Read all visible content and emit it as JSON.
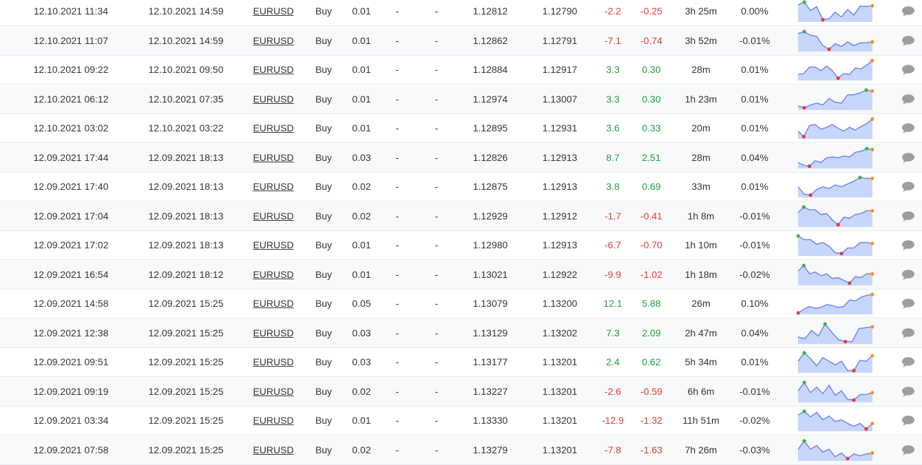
{
  "colors": {
    "positive": "#1ea03b",
    "negative": "#e53935",
    "sparkline_fill": "#c9d6fb",
    "sparkline_line": "#6f86f2",
    "marker_high": "#3cb043",
    "marker_low": "#e53935",
    "marker_last": "#ff8c1a",
    "comment_icon": "#9e9e9e"
  },
  "icons": {
    "sparkline": "sparkline-chart-icon",
    "comment": "comment-icon"
  },
  "trades": [
    {
      "open": "12.10.2021 11:34",
      "close": "12.10.2021 14:59",
      "symbol": "EURUSD",
      "action": "Buy",
      "lots": "0.01",
      "sl": "-",
      "tp": "-",
      "open_price": "1.12812",
      "close_price": "1.12790",
      "pips": "-2.2",
      "profit": "-0.25",
      "duration": "3h 25m",
      "gain": "0.00%",
      "positive": false,
      "spark": [
        0.85,
        1.0,
        0.55,
        0.75,
        0.05,
        0.1,
        0.45,
        0.2,
        0.6,
        0.3,
        0.78,
        0.76,
        0.8
      ],
      "hi": 1,
      "lo": 4
    },
    {
      "open": "12.10.2021 11:07",
      "close": "12.10.2021 14:59",
      "symbol": "EURUSD",
      "action": "Buy",
      "lots": "0.01",
      "sl": "-",
      "tp": "-",
      "open_price": "1.12862",
      "close_price": "1.12791",
      "pips": "-7.1",
      "profit": "-0.74",
      "duration": "3h 52m",
      "gain": "-0.01%",
      "positive": false,
      "spark": [
        0.9,
        1.0,
        0.8,
        0.75,
        0.25,
        0.05,
        0.35,
        0.2,
        0.45,
        0.25,
        0.4,
        0.4,
        0.45
      ],
      "hi": 1,
      "lo": 5
    },
    {
      "open": "12.10.2021 09:22",
      "close": "12.10.2021 09:50",
      "symbol": "EURUSD",
      "action": "Buy",
      "lots": "0.01",
      "sl": "-",
      "tp": "-",
      "open_price": "1.12884",
      "close_price": "1.12917",
      "pips": "3.3",
      "profit": "0.30",
      "duration": "28m",
      "gain": "0.01%",
      "positive": true,
      "spark": [
        0.25,
        0.3,
        0.65,
        0.65,
        0.45,
        0.7,
        0.45,
        0.05,
        0.3,
        0.25,
        0.6,
        0.55,
        0.75,
        1.0
      ],
      "hi": 13,
      "lo": 7
    },
    {
      "open": "12.10.2021 06:12",
      "close": "12.10.2021 07:35",
      "symbol": "EURUSD",
      "action": "Buy",
      "lots": "0.01",
      "sl": "-",
      "tp": "-",
      "open_price": "1.12974",
      "close_price": "1.13007",
      "pips": "3.3",
      "profit": "0.30",
      "duration": "1h 23m",
      "gain": "0.01%",
      "positive": true,
      "spark": [
        0.15,
        0.05,
        0.2,
        0.3,
        0.2,
        0.55,
        0.35,
        0.3,
        0.75,
        0.75,
        0.85,
        1.0,
        0.95
      ],
      "hi": 11,
      "lo": 1
    },
    {
      "open": "12.10.2021 03:02",
      "close": "12.10.2021 03:22",
      "symbol": "EURUSD",
      "action": "Buy",
      "lots": "0.01",
      "sl": "-",
      "tp": "-",
      "open_price": "1.12895",
      "close_price": "1.12931",
      "pips": "3.6",
      "profit": "0.33",
      "duration": "20m",
      "gain": "0.01%",
      "positive": true,
      "spark": [
        0.35,
        0.05,
        0.65,
        0.7,
        0.45,
        0.55,
        0.7,
        0.5,
        0.35,
        0.55,
        0.4,
        0.6,
        0.75,
        1.0
      ],
      "hi": 13,
      "lo": 1
    },
    {
      "open": "12.09.2021 17:44",
      "close": "12.09.2021 18:13",
      "symbol": "EURUSD",
      "action": "Buy",
      "lots": "0.03",
      "sl": "-",
      "tp": "-",
      "open_price": "1.12826",
      "close_price": "1.12913",
      "pips": "8.7",
      "profit": "2.51",
      "duration": "28m",
      "gain": "0.04%",
      "positive": true,
      "spark": [
        0.25,
        0.1,
        0.05,
        0.35,
        0.25,
        0.5,
        0.55,
        0.5,
        0.6,
        0.55,
        0.8,
        0.85,
        1.0,
        0.95
      ],
      "hi": 12,
      "lo": 2
    },
    {
      "open": "12.09.2021 17:40",
      "close": "12.09.2021 18:13",
      "symbol": "EURUSD",
      "action": "Buy",
      "lots": "0.02",
      "sl": "-",
      "tp": "-",
      "open_price": "1.12875",
      "close_price": "1.12913",
      "pips": "3.8",
      "profit": "0.69",
      "duration": "33m",
      "gain": "0.01%",
      "positive": true,
      "spark": [
        0.5,
        0.1,
        0.05,
        0.35,
        0.5,
        0.4,
        0.6,
        0.5,
        0.65,
        0.8,
        1.0,
        0.95,
        0.95
      ],
      "hi": 10,
      "lo": 2
    },
    {
      "open": "12.09.2021 17:04",
      "close": "12.09.2021 18:13",
      "symbol": "EURUSD",
      "action": "Buy",
      "lots": "0.02",
      "sl": "-",
      "tp": "-",
      "open_price": "1.12929",
      "close_price": "1.12912",
      "pips": "-1.7",
      "profit": "-0.41",
      "duration": "1h 8m",
      "gain": "-0.01%",
      "positive": false,
      "spark": [
        0.7,
        1.0,
        0.85,
        0.85,
        0.6,
        0.65,
        0.3,
        0.05,
        0.45,
        0.4,
        0.6,
        0.65,
        0.8,
        0.8
      ],
      "hi": 1,
      "lo": 7
    },
    {
      "open": "12.09.2021 17:02",
      "close": "12.09.2021 18:13",
      "symbol": "EURUSD",
      "action": "Buy",
      "lots": "0.01",
      "sl": "-",
      "tp": "-",
      "open_price": "1.12980",
      "close_price": "1.12913",
      "pips": "-6.7",
      "profit": "-0.70",
      "duration": "1h 10m",
      "gain": "-0.01%",
      "positive": false,
      "spark": [
        1.0,
        0.8,
        0.8,
        0.55,
        0.65,
        0.45,
        0.1,
        0.05,
        0.35,
        0.35,
        0.65,
        0.65,
        0.6
      ],
      "hi": 0,
      "lo": 7
    },
    {
      "open": "12.09.2021 16:54",
      "close": "12.09.2021 18:12",
      "symbol": "EURUSD",
      "action": "Buy",
      "lots": "0.01",
      "sl": "-",
      "tp": "-",
      "open_price": "1.13021",
      "close_price": "1.12922",
      "pips": "-9.9",
      "profit": "-1.02",
      "duration": "1h 18m",
      "gain": "-0.02%",
      "positive": false,
      "spark": [
        0.7,
        1.0,
        0.55,
        0.65,
        0.45,
        0.55,
        0.3,
        0.35,
        0.2,
        0.05,
        0.4,
        0.35,
        0.55,
        0.55
      ],
      "hi": 1,
      "lo": 9
    },
    {
      "open": "12.09.2021 14:58",
      "close": "12.09.2021 15:25",
      "symbol": "EURUSD",
      "action": "Buy",
      "lots": "0.05",
      "sl": "-",
      "tp": "-",
      "open_price": "1.13079",
      "close_price": "1.13200",
      "pips": "12.1",
      "profit": "5.88",
      "duration": "26m",
      "gain": "0.10%",
      "positive": true,
      "spark": [
        0.0,
        0.2,
        0.35,
        0.25,
        0.3,
        0.45,
        0.4,
        0.3,
        0.35,
        0.7,
        0.65,
        0.85,
        0.95,
        1.0
      ],
      "hi": 13,
      "lo": 0
    },
    {
      "open": "12.09.2021 12:38",
      "close": "12.09.2021 15:25",
      "symbol": "EURUSD",
      "action": "Buy",
      "lots": "0.03",
      "sl": "-",
      "tp": "-",
      "open_price": "1.13129",
      "close_price": "1.13202",
      "pips": "7.3",
      "profit": "2.09",
      "duration": "2h 47m",
      "gain": "0.04%",
      "positive": true,
      "spark": [
        0.3,
        0.2,
        0.65,
        0.35,
        1.0,
        0.55,
        0.15,
        0.05,
        0.05,
        0.75,
        0.8,
        0.85
      ],
      "hi": 4,
      "lo": 7
    },
    {
      "open": "12.09.2021 09:51",
      "close": "12.09.2021 15:25",
      "symbol": "EURUSD",
      "action": "Buy",
      "lots": "0.03",
      "sl": "-",
      "tp": "-",
      "open_price": "1.13177",
      "close_price": "1.13201",
      "pips": "2.4",
      "profit": "0.62",
      "duration": "5h 34m",
      "gain": "0.01%",
      "positive": true,
      "spark": [
        0.55,
        1.0,
        0.7,
        0.3,
        0.75,
        0.55,
        0.35,
        0.55,
        0.05,
        0.05,
        0.6,
        0.55,
        0.85
      ],
      "hi": 1,
      "lo": 9
    },
    {
      "open": "12.09.2021 09:19",
      "close": "12.09.2021 15:25",
      "symbol": "EURUSD",
      "action": "Buy",
      "lots": "0.02",
      "sl": "-",
      "tp": "-",
      "open_price": "1.13227",
      "close_price": "1.13201",
      "pips": "-2.6",
      "profit": "-0.59",
      "duration": "6h 6m",
      "gain": "-0.01%",
      "positive": false,
      "spark": [
        0.55,
        1.0,
        0.45,
        0.75,
        0.4,
        0.85,
        0.3,
        0.55,
        0.1,
        0.05,
        0.35,
        0.35,
        0.45
      ],
      "hi": 1,
      "lo": 9
    },
    {
      "open": "12.09.2021 03:34",
      "close": "12.09.2021 15:25",
      "symbol": "EURUSD",
      "action": "Buy",
      "lots": "0.01",
      "sl": "-",
      "tp": "-",
      "open_price": "1.13330",
      "close_price": "1.13201",
      "pips": "-12.9",
      "profit": "-1.32",
      "duration": "11h 51m",
      "gain": "-0.02%",
      "positive": false,
      "spark": [
        0.8,
        1.0,
        0.7,
        0.95,
        0.55,
        0.75,
        0.45,
        0.55,
        0.35,
        0.2,
        0.35,
        0.05,
        0.35
      ],
      "hi": 1,
      "lo": 11
    },
    {
      "open": "12.09.2021 07:58",
      "close": "12.09.2021 15:25",
      "symbol": "EURUSD",
      "action": "Buy",
      "lots": "0.02",
      "sl": "-",
      "tp": "-",
      "open_price": "1.13279",
      "close_price": "1.13201",
      "pips": "-7.8",
      "profit": "-1.63",
      "duration": "7h 26m",
      "gain": "-0.03%",
      "positive": false,
      "spark": [
        0.55,
        1.0,
        0.55,
        0.75,
        0.4,
        0.55,
        0.15,
        0.35,
        0.05,
        0.3,
        0.2,
        0.3,
        0.35
      ],
      "hi": 1,
      "lo": 8
    }
  ]
}
